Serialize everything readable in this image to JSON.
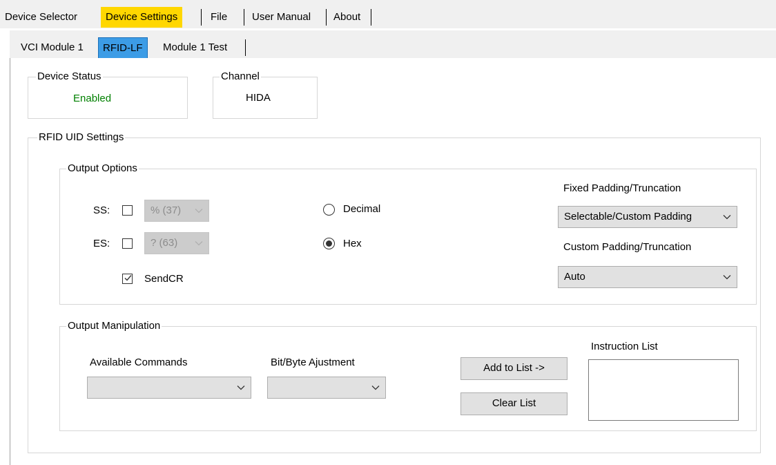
{
  "tabs_top": {
    "device_selector": "Device Selector",
    "device_settings": "Device Settings",
    "file": "File",
    "user_manual": "User Manual",
    "about": "About"
  },
  "tabs_sub": {
    "vci_module": "VCI Module 1",
    "rfid_lf": "RFID-LF",
    "module_test": "Module 1 Test"
  },
  "device_status": {
    "legend": "Device Status",
    "value": "Enabled",
    "value_color": "#008000"
  },
  "channel": {
    "legend": "Channel",
    "value": "HIDA"
  },
  "rfid_uid": {
    "legend": "RFID UID Settings",
    "output_options": {
      "legend": "Output Options",
      "ss_label": "SS:",
      "ss_checked": false,
      "ss_value": "% (37)",
      "es_label": "ES:",
      "es_checked": false,
      "es_value": "? (63)",
      "sendcr_label": "SendCR",
      "sendcr_checked": true,
      "decimal_label": "Decimal",
      "hex_label": "Hex",
      "selected_format": "Hex",
      "fixed_padding_label": "Fixed Padding/Truncation",
      "fixed_padding_value": "Selectable/Custom Padding",
      "custom_padding_label": "Custom Padding/Truncation",
      "custom_padding_value": "Auto"
    },
    "output_manipulation": {
      "legend": "Output Manipulation",
      "available_commands_label": "Available Commands",
      "available_commands_value": "",
      "bit_byte_label": "Bit/Byte Ajustment",
      "bit_byte_value": "",
      "add_to_list": "Add to List ->",
      "clear_list": "Clear List",
      "instruction_list_label": "Instruction List",
      "instruction_list_items": []
    }
  },
  "icons": {
    "dropdown": "chevron-down-icon",
    "checkmark": "checkmark-icon",
    "radio": "radio-dot-icon"
  }
}
